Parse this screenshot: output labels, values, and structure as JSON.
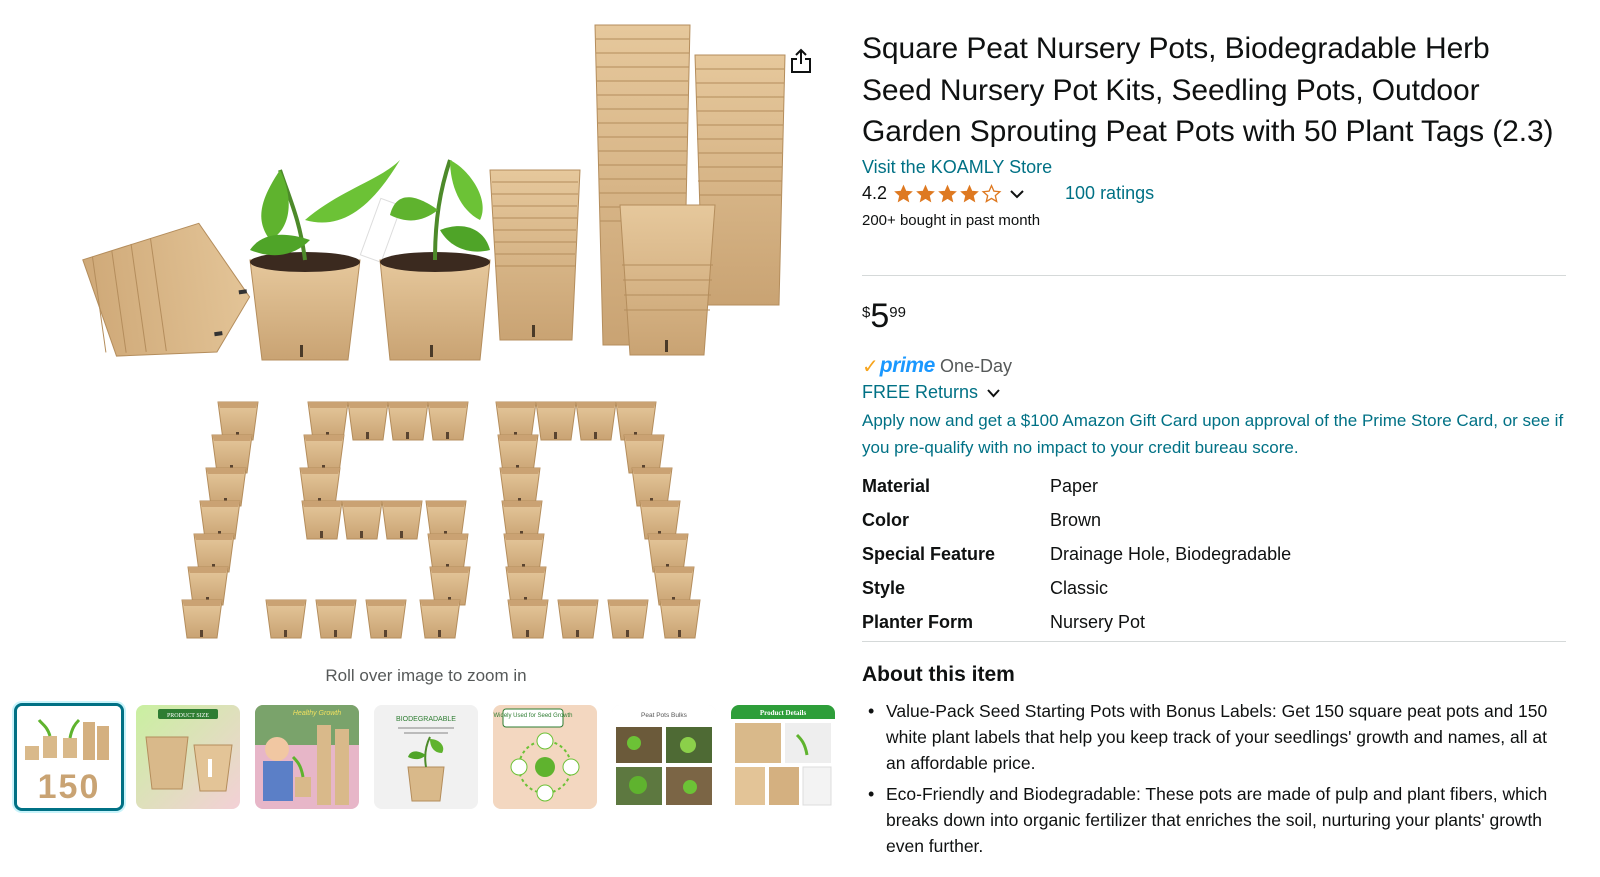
{
  "product": {
    "title": "Square Peat Nursery Pots, Biodegradable Herb Seed Nursery Pot Kits, Seedling Pots, Outdoor Garden Sprouting Peat Pots with 50 Plant Tags (2.3)",
    "store_link": "Visit the KOAMLY Store",
    "rating_value": "4.2",
    "rating_stars": 4.2,
    "ratings_count": "100 ratings",
    "bought_text": "200+ bought in past month"
  },
  "price": {
    "symbol": "$",
    "whole": "5",
    "fraction": "99"
  },
  "delivery": {
    "prime_check": "✓",
    "prime_word": "prime",
    "prime_speed": "One-Day",
    "returns": "FREE Returns",
    "promo": "Apply now and get a $100 Amazon Gift Card upon approval of the Prime Store Card, or see if you pre-qualify with no impact to your credit bureau score."
  },
  "specs": [
    {
      "key": "Material",
      "value": "Paper"
    },
    {
      "key": "Color",
      "value": "Brown"
    },
    {
      "key": "Special Feature",
      "value": "Drainage Hole, Biodegradable"
    },
    {
      "key": "Style",
      "value": "Classic"
    },
    {
      "key": "Planter Form",
      "value": "Nursery Pot"
    }
  ],
  "about": {
    "title": "About this item",
    "bullets": [
      "Value-Pack Seed Starting Pots with Bonus Labels: Get 150 square peat pots and 150 white plant labels that help you keep track of your seedlings' growth and names, all at an affordable price.",
      "Eco-Friendly and Biodegradable: These pots are made of pulp and plant fibers, which breaks down into organic fertilizer that enriches the soil, nurturing your plants' growth even further."
    ]
  },
  "gallery": {
    "zoom_hint": "Roll over image to zoom in",
    "main_image_text": "150",
    "thumbnails": [
      {
        "name": "thumb-150-pots",
        "caption": "150"
      },
      {
        "name": "thumb-product-size",
        "caption": "PRODUCT SIZE"
      },
      {
        "name": "thumb-healthy-growth",
        "caption": "Healthy Growth"
      },
      {
        "name": "thumb-biodegradable",
        "caption": "BIODEGRADABLE"
      },
      {
        "name": "thumb-seed-growth",
        "caption": "Widely Used for Seed Growth"
      },
      {
        "name": "thumb-peat-pots-bulks",
        "caption": "Peat Pots Bulks"
      },
      {
        "name": "thumb-product-details",
        "caption": "Product Details"
      }
    ]
  },
  "colors": {
    "link": "#007185",
    "star": "#de7921",
    "prime_blue": "#1a98ff",
    "prime_check": "#f7a41d",
    "peat": "#d9b98a",
    "peat_dark": "#b8925f"
  },
  "icons": {
    "share": "share-icon",
    "chevron": "chevron-down-icon",
    "star": "star-icon"
  }
}
